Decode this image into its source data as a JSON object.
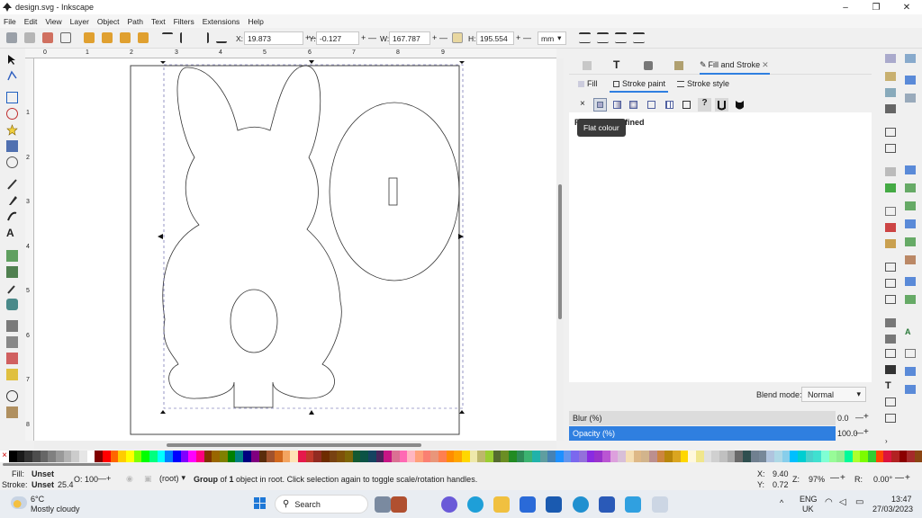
{
  "window": {
    "title": "design.svg - Inkscape",
    "controls": [
      "–",
      "❐",
      "✕"
    ]
  },
  "menu": [
    "File",
    "Edit",
    "View",
    "Layer",
    "Object",
    "Path",
    "Text",
    "Filters",
    "Extensions",
    "Help"
  ],
  "toolbar": {
    "x_label": "X:",
    "x_value": "19.873",
    "y_label": "Y:",
    "y_value": "-0.127",
    "w_label": "W:",
    "w_value": "167.787",
    "h_label": "H:",
    "h_value": "195.554",
    "unit": "mm",
    "plus": "+",
    "minus": "—"
  },
  "dialog": {
    "title_tab": "Fill and Stroke",
    "close": "✕",
    "subtabs": {
      "fill": "Fill",
      "stroke_paint": "Stroke paint",
      "stroke_style": "Stroke style"
    },
    "paint_none": "×",
    "paint_unset": "?",
    "paint_message": "Paint is undefined",
    "tooltip": "Flat colour",
    "blend_label": "Blend mode:",
    "blend_value": "Normal",
    "blur_label": "Blur (%)",
    "blur_value": "0.0",
    "opacity_label": "Opacity (%)",
    "opacity_value": "100.0",
    "opacity_fraction": 1.0
  },
  "status": {
    "fill_label": "Fill:",
    "fill_value": "Unset",
    "stroke_label": "Stroke:",
    "stroke_value": "Unset",
    "stroke_width": "25.4",
    "o_label": "O:",
    "o_value": "100",
    "layer": "(root)",
    "message_bold": "Group",
    "message_of": " of ",
    "message_count": "1",
    "message_rest": " object in root. Click selection again to toggle scale/rotation handles.",
    "x_label": "X:",
    "x_value": "9.40",
    "y_label": "Y:",
    "y_value": "0.72",
    "z_label": "Z:",
    "z_value": "97%",
    "r_label": "R:",
    "r_value": "0.00°"
  },
  "ruler_h": [
    "0",
    "1",
    "2",
    "3",
    "4",
    "5",
    "6",
    "7",
    "8",
    "9"
  ],
  "ruler_v": [
    "1",
    "2",
    "3",
    "4",
    "5",
    "6",
    "7",
    "8"
  ],
  "taskbar": {
    "temp": "6°C",
    "weather": "Mostly cloudy",
    "search": "Search",
    "lang1": "ENG",
    "lang2": "UK",
    "time": "13:47",
    "date": "27/03/2023",
    "tray_chevron": "^"
  },
  "colors": {
    "accent_blue": "#2f7fe0",
    "palette": [
      "#000000",
      "#1a1a1a",
      "#333333",
      "#4d4d4d",
      "#666666",
      "#808080",
      "#999999",
      "#b3b3b3",
      "#cccccc",
      "#e6e6e6",
      "#ffffff",
      "#800000",
      "#ff0000",
      "#ff6600",
      "#ffcc00",
      "#ffff00",
      "#80ff00",
      "#00ff00",
      "#00ff80",
      "#00ffff",
      "#0080ff",
      "#0000ff",
      "#8000ff",
      "#ff00ff",
      "#ff0080",
      "#803300",
      "#996600",
      "#808000",
      "#008000",
      "#008080",
      "#000080",
      "#800080",
      "#5a2d0c",
      "#a0522d",
      "#d2691e",
      "#f4a460",
      "#ffe4b5",
      "#e6194b",
      "#c0392b",
      "#922b21",
      "#6e2c00",
      "#784212",
      "#7e5109",
      "#7d6608",
      "#145a32",
      "#0b5345",
      "#154360",
      "#4a235a",
      "#c71585",
      "#db7093",
      "#ff69b4",
      "#ffb6c1",
      "#ffa07a",
      "#fa8072",
      "#e9967a",
      "#ff7f50",
      "#ff8c00",
      "#ffa500",
      "#ffd700",
      "#eee8aa",
      "#bdb76b",
      "#9acd32",
      "#556b2f",
      "#6b8e23",
      "#228b22",
      "#2e8b57",
      "#3cb371",
      "#20b2aa",
      "#5f9ea0",
      "#4682b4",
      "#1e90ff",
      "#6495ed",
      "#7b68ee",
      "#9370db",
      "#8a2be2",
      "#9932cc",
      "#ba55d3",
      "#dda0dd",
      "#d8bfd8",
      "#f5deb3",
      "#deb887",
      "#d2b48c",
      "#bc8f8f",
      "#cd853f",
      "#b8860b",
      "#daa520",
      "#ffd700",
      "#fff8dc",
      "#f0e68c",
      "#e0e0e0",
      "#d0d0d0",
      "#c0c0c0",
      "#a9a9a9",
      "#696969",
      "#2f4f4f",
      "#708090",
      "#778899",
      "#b0c4de",
      "#add8e6",
      "#87ceeb",
      "#00bfff",
      "#00ced1",
      "#48d1cc",
      "#40e0d0",
      "#7fffd4",
      "#98fb98",
      "#90ee90",
      "#00fa9a",
      "#adff2f",
      "#7cfc00",
      "#32cd32",
      "#ff4500",
      "#dc143c",
      "#b22222",
      "#8b0000",
      "#a52a2a",
      "#8b4513"
    ]
  }
}
